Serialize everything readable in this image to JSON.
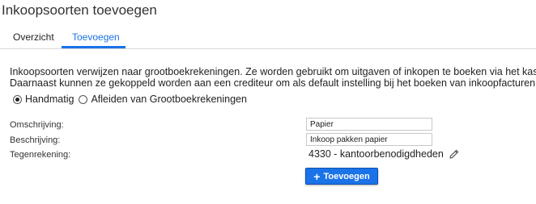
{
  "page": {
    "title": "Inkoopsoorten toevoegen"
  },
  "tabs": [
    {
      "label": "Overzicht",
      "active": false
    },
    {
      "label": "Toevoegen",
      "active": true
    }
  ],
  "accent_color": "#1a73e8",
  "intro": {
    "line1": "Inkoopsoorten verwijzen naar grootboekrekeningen. Ze worden gebruikt om uitgaven of inkopen te boeken via het kasblad.",
    "line2": "Daarnaast kunnen ze gekoppeld worden aan een crediteur om als default instelling bij het boeken van inkoopfacturen."
  },
  "mode": {
    "options": [
      {
        "label": "Handmatig",
        "selected": true
      },
      {
        "label": "Afleiden van Grootboekrekeningen",
        "selected": false
      }
    ]
  },
  "form": {
    "omschrijving": {
      "label": "Omschrijving:",
      "value": "Papier"
    },
    "beschrijving": {
      "label": "Beschrijving:",
      "value": "Inkoop pakken papier"
    },
    "tegenrekening": {
      "label": "Tegenrekening:",
      "value": "4330 - kantoorbenodigdheden",
      "edit_icon": "pencil-icon"
    }
  },
  "actions": {
    "add_icon": "plus-icon",
    "add_label": "Toevoegen"
  }
}
